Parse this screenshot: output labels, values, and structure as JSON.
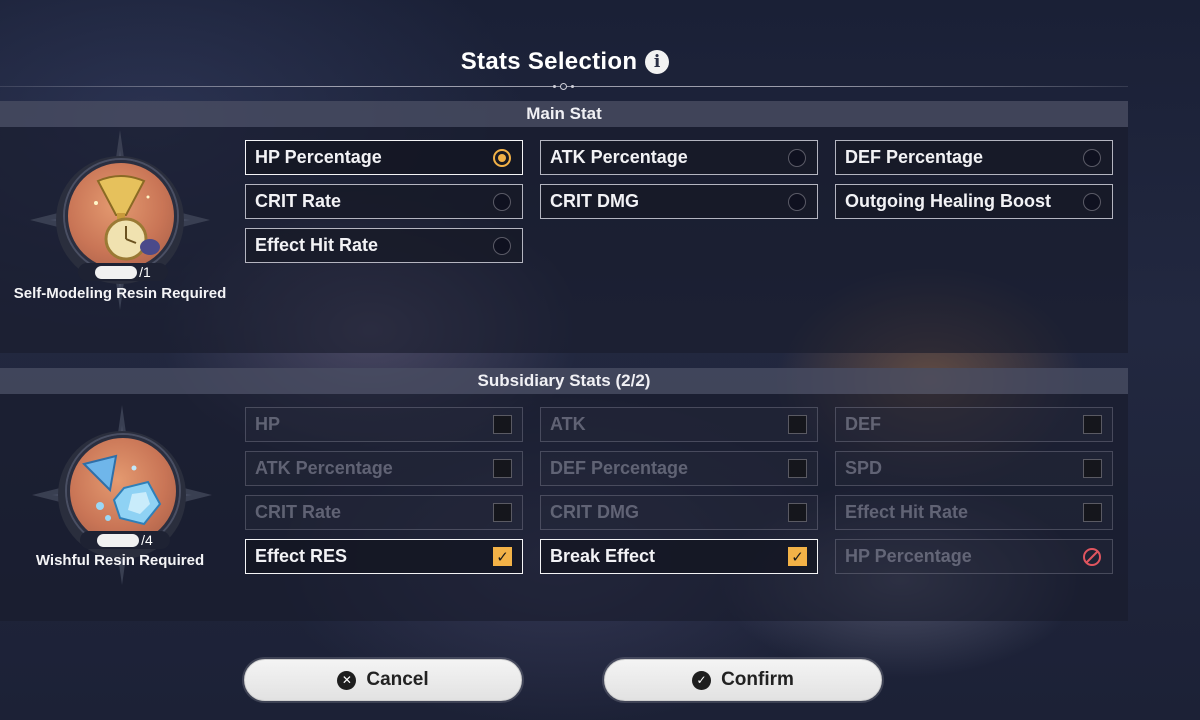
{
  "title": "Stats Selection",
  "main_section": {
    "header": "Main Stat",
    "resin_label": "Self-Modeling Resin Required",
    "counter_suffix": "/1",
    "options": [
      {
        "label": "HP Percentage",
        "state": "selected"
      },
      {
        "label": "ATK Percentage",
        "state": "unselected"
      },
      {
        "label": "DEF Percentage",
        "state": "unselected"
      },
      {
        "label": "CRIT Rate",
        "state": "unselected"
      },
      {
        "label": "CRIT DMG",
        "state": "unselected"
      },
      {
        "label": "Outgoing Healing Boost",
        "state": "unselected"
      },
      {
        "label": "Effect Hit Rate",
        "state": "unselected"
      }
    ]
  },
  "sub_section": {
    "header": "Subsidiary Stats (2/2)",
    "resin_label": "Wishful Resin Required",
    "counter_suffix": "/4",
    "options": [
      {
        "label": "HP",
        "state": "disabled"
      },
      {
        "label": "ATK",
        "state": "disabled"
      },
      {
        "label": "DEF",
        "state": "disabled"
      },
      {
        "label": "ATK Percentage",
        "state": "disabled"
      },
      {
        "label": "DEF Percentage",
        "state": "disabled"
      },
      {
        "label": "SPD",
        "state": "disabled"
      },
      {
        "label": "CRIT Rate",
        "state": "disabled"
      },
      {
        "label": "CRIT DMG",
        "state": "disabled"
      },
      {
        "label": "Effect Hit Rate",
        "state": "disabled"
      },
      {
        "label": "Effect RES",
        "state": "checked"
      },
      {
        "label": "Break Effect",
        "state": "checked"
      },
      {
        "label": "HP Percentage",
        "state": "blocked"
      }
    ]
  },
  "buttons": {
    "cancel": "Cancel",
    "confirm": "Confirm"
  },
  "colors": {
    "accent": "#f3b247",
    "blocked": "#e0555f",
    "button_bg": "#ececec"
  },
  "icons": {
    "info": "info-icon",
    "cancel": "close-circle-icon",
    "confirm": "check-circle-icon",
    "main_resin": "self-modeling-resin-icon",
    "sub_resin": "wishful-resin-icon"
  }
}
